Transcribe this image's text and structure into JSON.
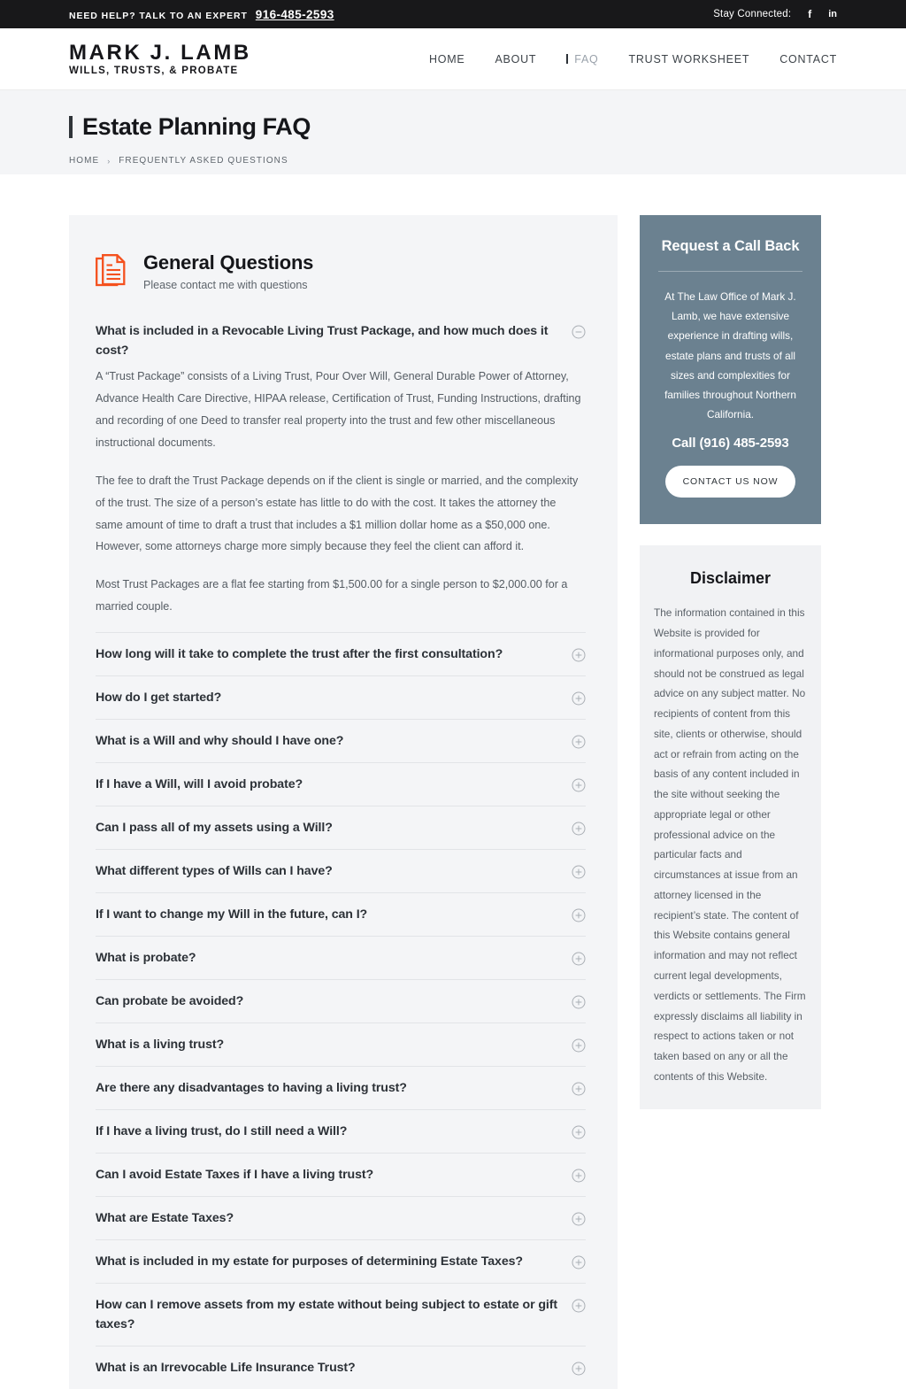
{
  "topbar": {
    "help_label": "NEED HELP? TALK TO AN EXPERT",
    "phone": "916-485-2593",
    "stay_connected_label": "Stay Connected:",
    "social": [
      {
        "name": "facebook-icon",
        "glyph": "f"
      },
      {
        "name": "linkedin-icon",
        "glyph": "in"
      }
    ]
  },
  "header": {
    "logo_main": "MARK J. LAMB",
    "logo_sub": "WILLS, TRUSTS, & PROBATE",
    "nav": [
      {
        "label": "HOME",
        "active": false
      },
      {
        "label": "ABOUT",
        "active": false
      },
      {
        "label": "FAQ",
        "active": true
      },
      {
        "label": "TRUST WORKSHEET",
        "active": false
      },
      {
        "label": "CONTACT",
        "active": false
      }
    ]
  },
  "banner": {
    "title": "Estate Planning FAQ",
    "breadcrumb_home": "HOME",
    "breadcrumb_sep": "›",
    "breadcrumb_current": "FREQUENTLY ASKED QUESTIONS"
  },
  "faq": {
    "section_icon": "document-icon",
    "section_title": "General Questions",
    "section_subtitle": "Please contact me with questions",
    "icon_open": "minus-circle-icon",
    "icon_closed": "plus-circle-icon",
    "items": [
      {
        "question": "What is included in a Revocable Living Trust Package, and how much does it cost?",
        "open": true,
        "answer": [
          "A “Trust Package” consists of a Living Trust, Pour Over Will, General Durable Power of Attorney, Advance Health Care Directive, HIPAA release, Certification of Trust, Funding Instructions, drafting and recording of one Deed to transfer real property into the trust and few other miscellaneous instructional documents.",
          "The fee to draft the Trust Package depends on if the client is single or married, and the complexity of the trust. The size of a person’s estate has little to do with the cost. It takes the attorney the same amount of time to draft a trust that includes a $1 million dollar home as a $50,000 one. However, some attorneys charge more simply because they feel the client can afford it.",
          "Most Trust Packages are a flat fee starting from $1,500.00 for a single person to $2,000.00 for a married couple."
        ]
      },
      {
        "question": "How long will it take to complete the trust after the first consultation?",
        "open": false,
        "answer": []
      },
      {
        "question": "How do I get started?",
        "open": false,
        "answer": []
      },
      {
        "question": "What is a Will and why should I have one?",
        "open": false,
        "answer": []
      },
      {
        "question": "If I have a Will, will I avoid probate?",
        "open": false,
        "answer": []
      },
      {
        "question": "Can I pass all of my assets using a Will?",
        "open": false,
        "answer": []
      },
      {
        "question": "What different types of Wills can I have?",
        "open": false,
        "answer": []
      },
      {
        "question": "If I want to change my Will in the future, can I?",
        "open": false,
        "answer": []
      },
      {
        "question": "What is probate?",
        "open": false,
        "answer": []
      },
      {
        "question": "Can probate be avoided?",
        "open": false,
        "answer": []
      },
      {
        "question": "What is a living trust?",
        "open": false,
        "answer": []
      },
      {
        "question": "Are there any disadvantages to having a living trust?",
        "open": false,
        "answer": []
      },
      {
        "question": "If I have a living trust, do I still need a Will?",
        "open": false,
        "answer": []
      },
      {
        "question": "Can I avoid Estate Taxes if I have a living trust?",
        "open": false,
        "answer": []
      },
      {
        "question": "What are Estate Taxes?",
        "open": false,
        "answer": []
      },
      {
        "question": "What is included in my estate for purposes of determining Estate Taxes?",
        "open": false,
        "answer": []
      },
      {
        "question": "How can I remove assets from my estate without being subject to estate or gift taxes?",
        "open": false,
        "answer": []
      },
      {
        "question": "What is an Irrevocable Life Insurance Trust?",
        "open": false,
        "answer": []
      }
    ]
  },
  "sidebar": {
    "callback": {
      "title": "Request a Call Back",
      "text": "At The Law Office of Mark J. Lamb, we have extensive experience in drafting wills, estate plans and trusts of all sizes and complexities for families throughout Northern California.",
      "phone_line": "Call (916) 485-2593",
      "button_label": "CONTACT US NOW"
    },
    "disclaimer": {
      "title": "Disclaimer",
      "text": "The information contained in this Website is provided for informational purposes only, and should not be construed as legal advice on any subject matter. No recipients of content from this site, clients or otherwise, should act or refrain from acting on the basis of any content included in the site without seeking the appropriate legal or other professional advice on the particular facts and circumstances at issue from an attorney licensed in the recipient’s state. The content of this Website contains general information and may not reflect current legal developments, verdicts or settlements. The Firm expressly disclaims all liability in respect to actions taken or not taken based on any or all the contents of this Website."
    }
  },
  "colors": {
    "accent_orange": "#f4511e",
    "topbar_dark": "#18181a",
    "panel_gray": "#f4f5f7",
    "widget_slate": "#6b8190"
  }
}
